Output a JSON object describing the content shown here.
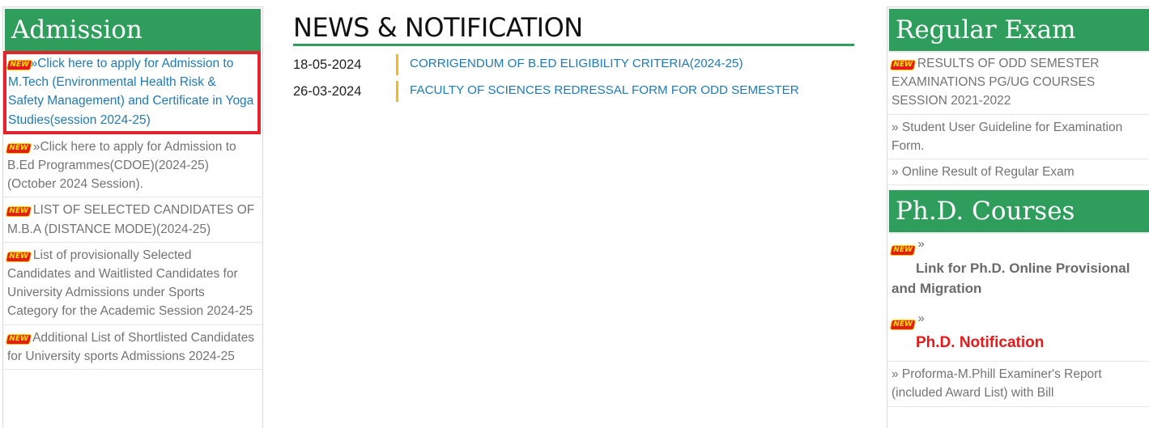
{
  "admission": {
    "title": "Admission",
    "new_badge": "NEW",
    "items": [
      {
        "prefix": "»",
        "text": "Click here to apply for Admission to M.Tech (Environmental Health Risk & Safety Management) and Certificate in Yoga Studies(session 2024-25)"
      },
      {
        "prefix": "»",
        "text": "Click here to apply for Admission to B.Ed Programmes(CDOE)(2024-25)(October 2024 Session)."
      },
      {
        "prefix": "",
        "text": "LIST OF SELECTED CANDIDATES OF M.B.A (DISTANCE MODE)(2024-25)"
      },
      {
        "prefix": "",
        "text": "List of provisionally Selected Candidates and Waitlisted Candidates for University Admissions under Sports Category for the Academic Session 2024-25"
      },
      {
        "prefix": "",
        "text": "Additional List of Shortlisted Candidates for University sports Admissions 2024-25"
      }
    ]
  },
  "news": {
    "title": "NEWS & NOTIFICATION",
    "rows": [
      {
        "date": "18-05-2024",
        "text": "CORRIGENDUM OF B.ED ELIGIBILITY CRITERIA(2024-25)"
      },
      {
        "date": "26-03-2024",
        "text": "FACULTY OF SCIENCES REDRESSAL FORM FOR ODD SEMESTER"
      }
    ]
  },
  "regular_exam": {
    "title": "Regular Exam",
    "items": [
      {
        "text": "RESULTS OF ODD SEMESTER EXAMINATIONS PG/UG COURSES SESSION 2021-2022"
      },
      {
        "text": "» Student User Guideline for Examination Form."
      },
      {
        "text": "» Online Result of Regular Exam"
      }
    ]
  },
  "phd": {
    "title": "Ph.D. Courses",
    "raquo": "»",
    "items": [
      {
        "text": "Link for Ph.D. Online Provisional and Migration"
      },
      {
        "text": "Ph.D. Notification"
      },
      {
        "text": "» Proforma-M.Phill Examiner's Report (included Award List) with Bill"
      }
    ]
  },
  "colors": {
    "green": "#2f9e5c",
    "link": "#1f7ab7",
    "highlight": "#e3232d",
    "accent_bar": "#f5b820"
  }
}
